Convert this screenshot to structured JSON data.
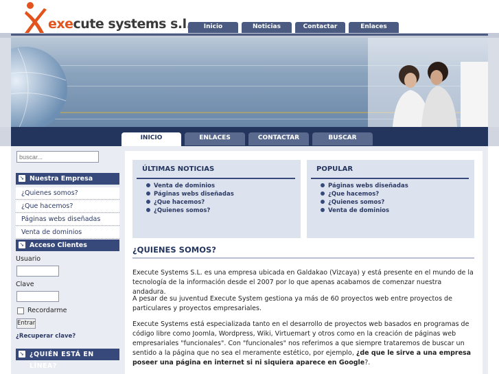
{
  "logo": {
    "prefix": "exe",
    "rest": "cute systems s.l."
  },
  "top_tabs": [
    "Inicio",
    "Noticias",
    "Contactar",
    "Enlaces"
  ],
  "nav_tabs": [
    "INICIO",
    "ENLACES",
    "CONTACTAR",
    "BUSCAR"
  ],
  "search": {
    "placeholder": "buscar..."
  },
  "sidebar": {
    "empresa_title": "Nuestra Empresa",
    "empresa_items": [
      "¿Quienes somos?",
      "¿Que hacemos?",
      "Páginas webs diseñadas",
      "Venta de dominios"
    ],
    "acceso_title": "Acceso Clientes",
    "usuario_label": "Usuario",
    "clave_label": "Clave",
    "recordarme_label": "Recordarme",
    "entrar_label": "Entrar",
    "recuperar_link": "¿Recuperar clave?",
    "online_title": "¿QUIÉN ESTÁ EN LÍNEA?"
  },
  "news_box": {
    "title": "ÚLTIMAS NOTICIAS",
    "items": [
      "Venta de dominios",
      "Páginas webs diseñadas",
      "¿Que hacemos?",
      "¿Quienes somos?"
    ]
  },
  "popular_box": {
    "title": "POPULAR",
    "items": [
      "Páginas webs diseñadas",
      "¿Que hacemos?",
      "¿Quienes somos?",
      "Venta de dominios"
    ]
  },
  "article": {
    "title": "¿QUIENES SOMOS?",
    "p1": "Execute Systems S.L. es una empresa ubicada en Galdakao (Vizcaya) y está presente en el mundo de la tecnología de la información desde el 2007 por lo que apenas acabamos de comenzar nuestra andadura.",
    "p2": "A pesar de su juventud Execute System gestiona ya más de 60 proyectos web entre proyectos de particulares y proyectos empresariales.",
    "p3_start": "Execute Systems está especializada tanto en el desarrollo de proyectos web basados en programas de código libre como Joomla, Wordpress, Wiki, Virtuemart y otros como en la creación de páginas web empresariales \"funcionales\". Con \"funcionales\" nos referimos a que siempre trataremos de buscar un sentido a la página que no sea el meramente estético, por ejemplo, ",
    "p3_bold": "¿de que le sirve a una empresa poseer una página en internet si ni siquiera aparece en Google",
    "p3_end": "?."
  },
  "colors": {
    "brand_orange": "#e2531d",
    "navy": "#24355d",
    "tab_blue": "#4a5a80"
  }
}
